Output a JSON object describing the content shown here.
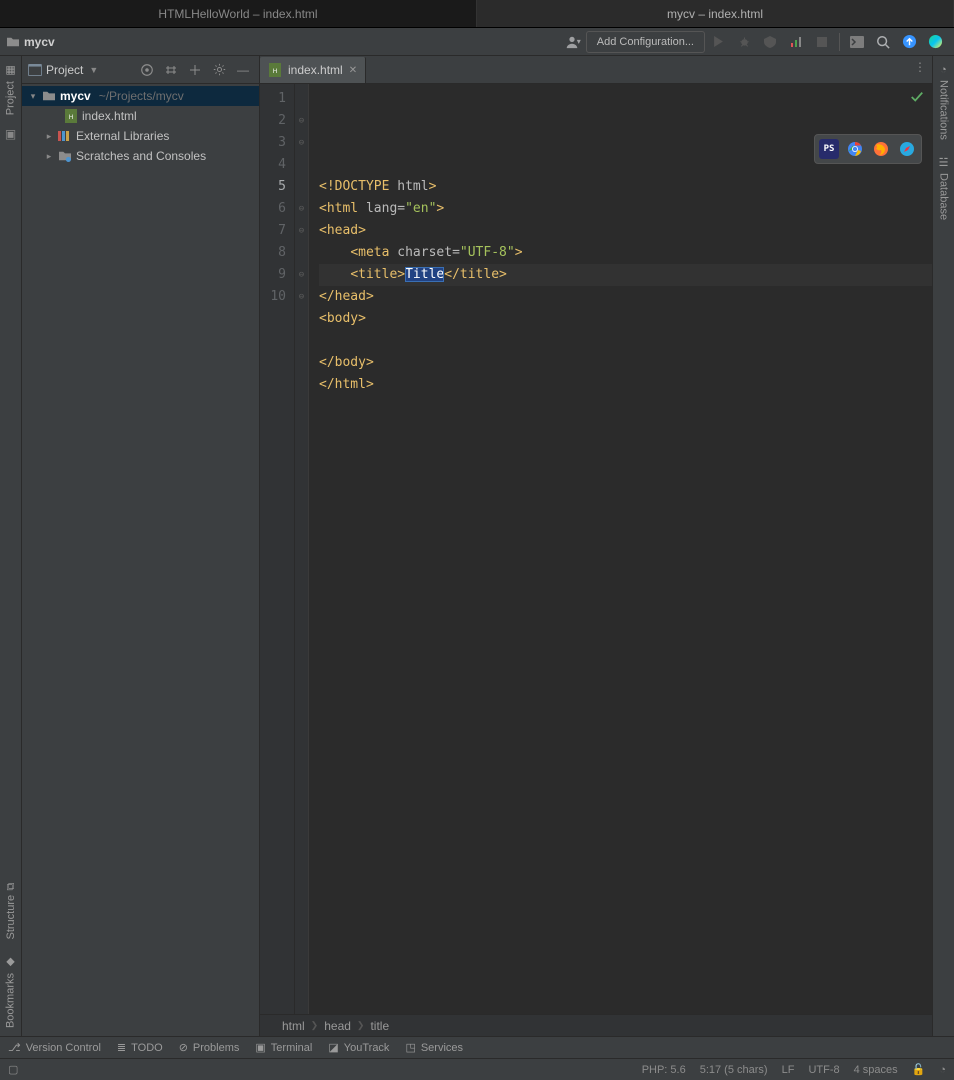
{
  "windows": {
    "tabs": [
      {
        "label": "HTMLHelloWorld – index.html",
        "active": false
      },
      {
        "label": "mycv – index.html",
        "active": true
      }
    ]
  },
  "navbar": {
    "crumb_project": "mycv",
    "add_config_label": "Add Configuration..."
  },
  "project_tool": {
    "title": "Project",
    "root": {
      "name": "mycv",
      "path": "~/Projects/mycv"
    },
    "file": "index.html",
    "external_libs": "External Libraries",
    "scratches": "Scratches and Consoles"
  },
  "editor": {
    "tab_filename": "index.html",
    "current_line": 5,
    "lines": [
      {
        "n": 1,
        "segments": [
          [
            "<!",
            "doc"
          ],
          [
            "DOCTYPE ",
            "doc"
          ],
          [
            "html",
            "attr"
          ],
          [
            ">",
            "doc"
          ]
        ]
      },
      {
        "n": 2,
        "segments": [
          [
            "<",
            "tag"
          ],
          [
            "html ",
            "tag"
          ],
          [
            "lang",
            "attr"
          ],
          [
            "=",
            "attr"
          ],
          [
            "\"en\"",
            "val"
          ],
          [
            ">",
            "tag"
          ]
        ]
      },
      {
        "n": 3,
        "segments": [
          [
            "<",
            "tag"
          ],
          [
            "head",
            "tag"
          ],
          [
            ">",
            "tag"
          ]
        ]
      },
      {
        "n": 4,
        "indent": 1,
        "segments": [
          [
            "<",
            "tag"
          ],
          [
            "meta ",
            "tag"
          ],
          [
            "charset",
            "attr"
          ],
          [
            "=",
            "attr"
          ],
          [
            "\"UTF-8\"",
            "val"
          ],
          [
            ">",
            "tag"
          ]
        ]
      },
      {
        "n": 5,
        "indent": 1,
        "segments": [
          [
            "<",
            "tag"
          ],
          [
            "title",
            "tag"
          ],
          [
            ">",
            "tag"
          ],
          [
            "Title",
            "sel"
          ],
          [
            "</",
            "tag"
          ],
          [
            "title",
            "tag"
          ],
          [
            ">",
            "tag"
          ]
        ],
        "highlight": true
      },
      {
        "n": 6,
        "segments": [
          [
            "</",
            "tag"
          ],
          [
            "head",
            "tag"
          ],
          [
            ">",
            "tag"
          ]
        ]
      },
      {
        "n": 7,
        "segments": [
          [
            "<",
            "tag"
          ],
          [
            "body",
            "tag"
          ],
          [
            ">",
            "tag"
          ]
        ]
      },
      {
        "n": 8,
        "segments": [
          [
            "",
            "text"
          ]
        ]
      },
      {
        "n": 9,
        "segments": [
          [
            "</",
            "tag"
          ],
          [
            "body",
            "tag"
          ],
          [
            ">",
            "tag"
          ]
        ]
      },
      {
        "n": 10,
        "segments": [
          [
            "</",
            "tag"
          ],
          [
            "html",
            "tag"
          ],
          [
            ">",
            "tag"
          ]
        ]
      }
    ],
    "breadcrumbs": [
      "html",
      "head",
      "title"
    ]
  },
  "right_gutter": {
    "notifications": "Notifications",
    "database": "Database"
  },
  "left_gutter": {
    "project": "Project",
    "structure": "Structure",
    "bookmarks": "Bookmarks"
  },
  "bottom_tabs": {
    "version_control": "Version Control",
    "todo": "TODO",
    "problems": "Problems",
    "terminal": "Terminal",
    "youtrack": "YouTrack",
    "services": "Services"
  },
  "status": {
    "php": "PHP: 5.6",
    "caret": "5:17 (5 chars)",
    "line_sep": "LF",
    "encoding": "UTF-8",
    "indent": "4 spaces"
  }
}
